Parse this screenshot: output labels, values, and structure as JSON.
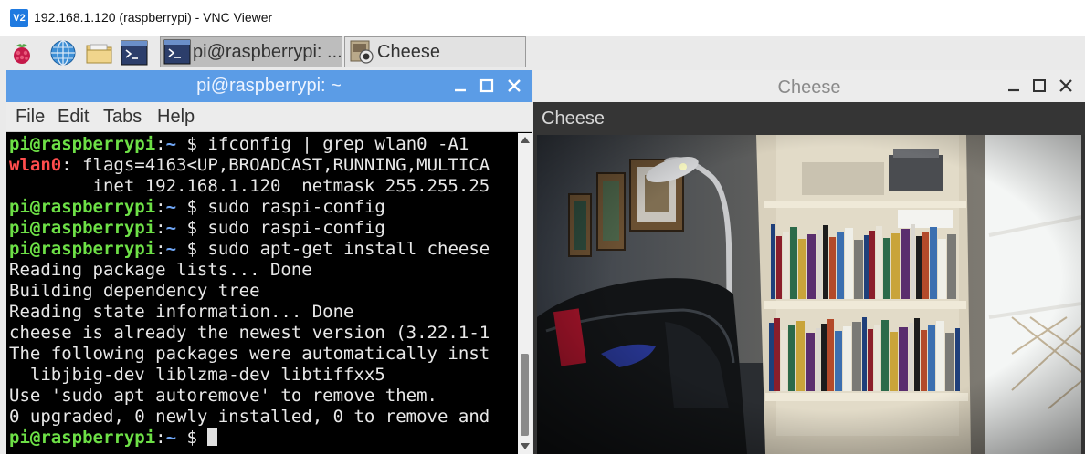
{
  "vnc": {
    "logo": "V2",
    "title": "192.168.1.120 (raspberrypi) - VNC Viewer"
  },
  "taskbar": {
    "icons": [
      "raspberry-menu-icon",
      "globe-icon",
      "folder-icon",
      "terminal-icon"
    ],
    "tasks": [
      {
        "label": "pi@raspberrypi: ...",
        "icon": "terminal-icon",
        "active": true
      },
      {
        "label": "Cheese",
        "icon": "webcam-icon",
        "active": false
      }
    ]
  },
  "terminal": {
    "title": "pi@raspberrypi: ~",
    "menu": [
      "File",
      "Edit",
      "Tabs",
      "Help"
    ],
    "prompt": {
      "user": "pi@raspberrypi",
      "sep": ":",
      "path": "~",
      "dollar": " $ "
    },
    "lines": [
      {
        "kind": "prompt",
        "cmd": "ifconfig | grep wlan0 -A1"
      },
      {
        "kind": "iface",
        "name": "wlan0",
        "rest": ": flags=4163<UP,BROADCAST,RUNNING,MULTICA"
      },
      {
        "kind": "out",
        "text": "        inet 192.168.1.120  netmask 255.255.25"
      },
      {
        "kind": "prompt",
        "cmd": "sudo raspi-config"
      },
      {
        "kind": "prompt",
        "cmd": "sudo raspi-config"
      },
      {
        "kind": "prompt",
        "cmd": "sudo apt-get install cheese"
      },
      {
        "kind": "out",
        "text": "Reading package lists... Done"
      },
      {
        "kind": "out",
        "text": "Building dependency tree"
      },
      {
        "kind": "out",
        "text": "Reading state information... Done"
      },
      {
        "kind": "out",
        "text": "cheese is already the newest version (3.22.1-1"
      },
      {
        "kind": "out",
        "text": "The following packages were automatically inst"
      },
      {
        "kind": "out",
        "text": "  libjbig-dev liblzma-dev libtiffxx5"
      },
      {
        "kind": "out",
        "text": "Use 'sudo apt autoremove' to remove them."
      },
      {
        "kind": "out",
        "text": "0 upgraded, 0 newly installed, 0 to remove and"
      },
      {
        "kind": "prompt",
        "cmd": "",
        "cursor": true
      }
    ]
  },
  "cheese": {
    "title": "Cheese",
    "header": "Cheese"
  },
  "colors": {
    "terminal_title": "#5b9ce6",
    "prompt_user": "#6de046",
    "prompt_path": "#6fa6f5",
    "iface_name": "#ff4d4d"
  }
}
